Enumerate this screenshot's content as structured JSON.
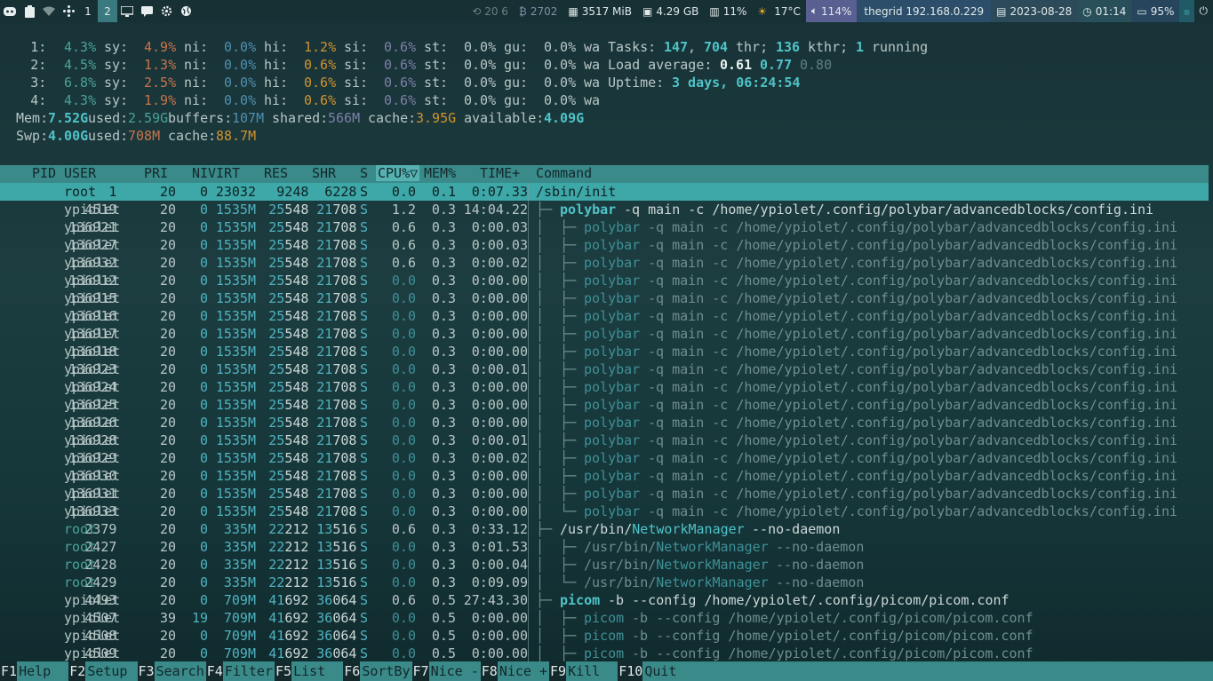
{
  "topbar": {
    "workspaces": [
      "1",
      "2"
    ],
    "active_workspace": "2",
    "blocks": {
      "updates": "20 ⁠6",
      "coins": "2702",
      "mem": "3517 MiB",
      "disk": "4.29 GB",
      "cpu": "11%",
      "temp": "17°C",
      "volume": "114%",
      "host": "thegrid 192.168.0.229",
      "date": "2023-08-28",
      "time": "01:14",
      "battery": "95%"
    }
  },
  "meters": {
    "cpus": [
      {
        "id": "1:",
        "us": "4.3%",
        "sy": "4.9%",
        "ni": "0.0%",
        "hi": "1.2%",
        "si": "0.6%",
        "st": "0.0%",
        "gu": "0.0%"
      },
      {
        "id": "2:",
        "us": "4.5%",
        "sy": "1.3%",
        "ni": "0.0%",
        "hi": "0.6%",
        "si": "0.6%",
        "st": "0.0%",
        "gu": "0.0%"
      },
      {
        "id": "3:",
        "us": "6.8%",
        "sy": "2.5%",
        "ni": "0.0%",
        "hi": "0.6%",
        "si": "0.6%",
        "st": "0.0%",
        "gu": "0.0%"
      },
      {
        "id": "4:",
        "us": "4.3%",
        "sy": "1.9%",
        "ni": "0.0%",
        "hi": "0.6%",
        "si": "0.6%",
        "st": "0.0%",
        "gu": "0.0%"
      }
    ],
    "labels": {
      "sy": "sy:",
      "ni": "ni:",
      "hi": "hi:",
      "si": "si:",
      "st": "st:",
      "gu": "gu:",
      "wa": "wa"
    },
    "tasks": {
      "label": "Tasks:",
      "tasks": "147",
      "thr": "704",
      "thr_label": "thr;",
      "kthr": "136",
      "kthr_label": "kthr;",
      "running": "1",
      "running_label": "running"
    },
    "load": {
      "label": "Load average:",
      "l1": "0.61",
      "l5": "0.77",
      "l15": "0.80"
    },
    "uptime": {
      "label": "Uptime:",
      "value": "3 days, 06:24:54"
    },
    "mem": {
      "label": "Mem:",
      "total": "7.52G",
      "used_label": "used:",
      "used": "2.59G",
      "buffers_label": "buffers:",
      "buffers": "107M",
      "shared_label": "shared:",
      "shared": "566M",
      "cache_label": "cache:",
      "cache": "3.95G",
      "avail_label": "available:",
      "avail": "4.09G"
    },
    "swp": {
      "label": "Swp:",
      "total": "4.00G",
      "used_label": "used:",
      "used": "708M",
      "cache_label": "cache:",
      "cache": "88.7M"
    }
  },
  "table": {
    "headers": [
      "PID",
      "USER",
      "PRI",
      "NI",
      "VIRT",
      "RES",
      "SHR",
      "S",
      "CPU%▽",
      "MEM%",
      "TIME+",
      "Command"
    ],
    "rows": [
      {
        "pid": "1",
        "user": "root",
        "pri": "20",
        "ni": "0",
        "virt": "23032",
        "res": "9248",
        "shr": "6228",
        "s": "S",
        "cpu": "0.0",
        "mem": "0.1",
        "time": "0:07.33",
        "tree": "",
        "cmd_bin": "/sbin/init",
        "cmd_args": "",
        "sel": true,
        "child": false
      },
      {
        "pid": "4519",
        "user": "ypiolet",
        "pri": "20",
        "ni": "0",
        "virt": "1535M",
        "res": "25548",
        "shr": "21708",
        "s": "S",
        "cpu": "1.2",
        "mem": "0.3",
        "time": "14:04.22",
        "tree": "├─ ",
        "cmd_bin": "polybar",
        "cmd_args": " -q main -c /home/ypiolet/.config/polybar/advancedblocks/config.ini",
        "child": false
      },
      {
        "pid": "136921",
        "user": "ypiolet",
        "pri": "20",
        "ni": "0",
        "virt": "1535M",
        "res": "25548",
        "shr": "21708",
        "s": "S",
        "cpu": "0.6",
        "mem": "0.3",
        "time": "0:00.03",
        "tree": "│  ├─ ",
        "cmd_bin": "polybar",
        "cmd_args": " -q main -c /home/ypiolet/.config/polybar/advancedblocks/config.ini",
        "child": true
      },
      {
        "pid": "136927",
        "user": "ypiolet",
        "pri": "20",
        "ni": "0",
        "virt": "1535M",
        "res": "25548",
        "shr": "21708",
        "s": "S",
        "cpu": "0.6",
        "mem": "0.3",
        "time": "0:00.03",
        "tree": "│  ├─ ",
        "cmd_bin": "polybar",
        "cmd_args": " -q main -c /home/ypiolet/.config/polybar/advancedblocks/config.ini",
        "child": true
      },
      {
        "pid": "136932",
        "user": "ypiolet",
        "pri": "20",
        "ni": "0",
        "virt": "1535M",
        "res": "25548",
        "shr": "21708",
        "s": "S",
        "cpu": "0.6",
        "mem": "0.3",
        "time": "0:00.02",
        "tree": "│  ├─ ",
        "cmd_bin": "polybar",
        "cmd_args": " -q main -c /home/ypiolet/.config/polybar/advancedblocks/config.ini",
        "child": true
      },
      {
        "pid": "136912",
        "user": "ypiolet",
        "pri": "20",
        "ni": "0",
        "virt": "1535M",
        "res": "25548",
        "shr": "21708",
        "s": "S",
        "cpu": "0.0",
        "mem": "0.3",
        "time": "0:00.00",
        "tree": "│  ├─ ",
        "cmd_bin": "polybar",
        "cmd_args": " -q main -c /home/ypiolet/.config/polybar/advancedblocks/config.ini",
        "child": true
      },
      {
        "pid": "136915",
        "user": "ypiolet",
        "pri": "20",
        "ni": "0",
        "virt": "1535M",
        "res": "25548",
        "shr": "21708",
        "s": "S",
        "cpu": "0.0",
        "mem": "0.3",
        "time": "0:00.00",
        "tree": "│  ├─ ",
        "cmd_bin": "polybar",
        "cmd_args": " -q main -c /home/ypiolet/.config/polybar/advancedblocks/config.ini",
        "child": true
      },
      {
        "pid": "136916",
        "user": "ypiolet",
        "pri": "20",
        "ni": "0",
        "virt": "1535M",
        "res": "25548",
        "shr": "21708",
        "s": "S",
        "cpu": "0.0",
        "mem": "0.3",
        "time": "0:00.00",
        "tree": "│  ├─ ",
        "cmd_bin": "polybar",
        "cmd_args": " -q main -c /home/ypiolet/.config/polybar/advancedblocks/config.ini",
        "child": true
      },
      {
        "pid": "136917",
        "user": "ypiolet",
        "pri": "20",
        "ni": "0",
        "virt": "1535M",
        "res": "25548",
        "shr": "21708",
        "s": "S",
        "cpu": "0.0",
        "mem": "0.3",
        "time": "0:00.00",
        "tree": "│  ├─ ",
        "cmd_bin": "polybar",
        "cmd_args": " -q main -c /home/ypiolet/.config/polybar/advancedblocks/config.ini",
        "child": true
      },
      {
        "pid": "136918",
        "user": "ypiolet",
        "pri": "20",
        "ni": "0",
        "virt": "1535M",
        "res": "25548",
        "shr": "21708",
        "s": "S",
        "cpu": "0.0",
        "mem": "0.3",
        "time": "0:00.00",
        "tree": "│  ├─ ",
        "cmd_bin": "polybar",
        "cmd_args": " -q main -c /home/ypiolet/.config/polybar/advancedblocks/config.ini",
        "child": true
      },
      {
        "pid": "136923",
        "user": "ypiolet",
        "pri": "20",
        "ni": "0",
        "virt": "1535M",
        "res": "25548",
        "shr": "21708",
        "s": "S",
        "cpu": "0.0",
        "mem": "0.3",
        "time": "0:00.01",
        "tree": "│  ├─ ",
        "cmd_bin": "polybar",
        "cmd_args": " -q main -c /home/ypiolet/.config/polybar/advancedblocks/config.ini",
        "child": true
      },
      {
        "pid": "136924",
        "user": "ypiolet",
        "pri": "20",
        "ni": "0",
        "virt": "1535M",
        "res": "25548",
        "shr": "21708",
        "s": "S",
        "cpu": "0.0",
        "mem": "0.3",
        "time": "0:00.00",
        "tree": "│  ├─ ",
        "cmd_bin": "polybar",
        "cmd_args": " -q main -c /home/ypiolet/.config/polybar/advancedblocks/config.ini",
        "child": true
      },
      {
        "pid": "136925",
        "user": "ypiolet",
        "pri": "20",
        "ni": "0",
        "virt": "1535M",
        "res": "25548",
        "shr": "21708",
        "s": "S",
        "cpu": "0.0",
        "mem": "0.3",
        "time": "0:00.00",
        "tree": "│  ├─ ",
        "cmd_bin": "polybar",
        "cmd_args": " -q main -c /home/ypiolet/.config/polybar/advancedblocks/config.ini",
        "child": true
      },
      {
        "pid": "136926",
        "user": "ypiolet",
        "pri": "20",
        "ni": "0",
        "virt": "1535M",
        "res": "25548",
        "shr": "21708",
        "s": "S",
        "cpu": "0.0",
        "mem": "0.3",
        "time": "0:00.00",
        "tree": "│  ├─ ",
        "cmd_bin": "polybar",
        "cmd_args": " -q main -c /home/ypiolet/.config/polybar/advancedblocks/config.ini",
        "child": true
      },
      {
        "pid": "136928",
        "user": "ypiolet",
        "pri": "20",
        "ni": "0",
        "virt": "1535M",
        "res": "25548",
        "shr": "21708",
        "s": "S",
        "cpu": "0.0",
        "mem": "0.3",
        "time": "0:00.01",
        "tree": "│  ├─ ",
        "cmd_bin": "polybar",
        "cmd_args": " -q main -c /home/ypiolet/.config/polybar/advancedblocks/config.ini",
        "child": true
      },
      {
        "pid": "136929",
        "user": "ypiolet",
        "pri": "20",
        "ni": "0",
        "virt": "1535M",
        "res": "25548",
        "shr": "21708",
        "s": "S",
        "cpu": "0.0",
        "mem": "0.3",
        "time": "0:00.02",
        "tree": "│  ├─ ",
        "cmd_bin": "polybar",
        "cmd_args": " -q main -c /home/ypiolet/.config/polybar/advancedblocks/config.ini",
        "child": true
      },
      {
        "pid": "136930",
        "user": "ypiolet",
        "pri": "20",
        "ni": "0",
        "virt": "1535M",
        "res": "25548",
        "shr": "21708",
        "s": "S",
        "cpu": "0.0",
        "mem": "0.3",
        "time": "0:00.00",
        "tree": "│  ├─ ",
        "cmd_bin": "polybar",
        "cmd_args": " -q main -c /home/ypiolet/.config/polybar/advancedblocks/config.ini",
        "child": true
      },
      {
        "pid": "136931",
        "user": "ypiolet",
        "pri": "20",
        "ni": "0",
        "virt": "1535M",
        "res": "25548",
        "shr": "21708",
        "s": "S",
        "cpu": "0.0",
        "mem": "0.3",
        "time": "0:00.00",
        "tree": "│  ├─ ",
        "cmd_bin": "polybar",
        "cmd_args": " -q main -c /home/ypiolet/.config/polybar/advancedblocks/config.ini",
        "child": true
      },
      {
        "pid": "136933",
        "user": "ypiolet",
        "pri": "20",
        "ni": "0",
        "virt": "1535M",
        "res": "25548",
        "shr": "21708",
        "s": "S",
        "cpu": "0.0",
        "mem": "0.3",
        "time": "0:00.00",
        "tree": "│  └─ ",
        "cmd_bin": "polybar",
        "cmd_args": " -q main -c /home/ypiolet/.config/polybar/advancedblocks/config.ini",
        "child": true
      },
      {
        "pid": "2379",
        "user": "root",
        "pri": "20",
        "ni": "0",
        "virt": "335M",
        "res": "22212",
        "shr": "13516",
        "s": "S",
        "cpu": "0.6",
        "mem": "0.3",
        "time": "0:33.12",
        "tree": "├─ ",
        "cmd_bin": "/usr/bin/NetworkManager",
        "cmd_args": " --no-daemon",
        "child": false
      },
      {
        "pid": "2427",
        "user": "root",
        "pri": "20",
        "ni": "0",
        "virt": "335M",
        "res": "22212",
        "shr": "13516",
        "s": "S",
        "cpu": "0.0",
        "mem": "0.3",
        "time": "0:01.53",
        "tree": "│  ├─ ",
        "cmd_bin": "/usr/bin/NetworkManager",
        "cmd_args": " --no-daemon",
        "child": true
      },
      {
        "pid": "2428",
        "user": "root",
        "pri": "20",
        "ni": "0",
        "virt": "335M",
        "res": "22212",
        "shr": "13516",
        "s": "S",
        "cpu": "0.0",
        "mem": "0.3",
        "time": "0:00.04",
        "tree": "│  ├─ ",
        "cmd_bin": "/usr/bin/NetworkManager",
        "cmd_args": " --no-daemon",
        "child": true
      },
      {
        "pid": "2429",
        "user": "root",
        "pri": "20",
        "ni": "0",
        "virt": "335M",
        "res": "22212",
        "shr": "13516",
        "s": "S",
        "cpu": "0.0",
        "mem": "0.3",
        "time": "0:09.09",
        "tree": "│  └─ ",
        "cmd_bin": "/usr/bin/NetworkManager",
        "cmd_args": " --no-daemon",
        "child": true
      },
      {
        "pid": "4493",
        "user": "ypiolet",
        "pri": "20",
        "ni": "0",
        "virt": "709M",
        "res": "41692",
        "shr": "36064",
        "s": "S",
        "cpu": "0.6",
        "mem": "0.5",
        "time": "27:43.30",
        "tree": "├─ ",
        "cmd_bin": "picom",
        "cmd_args": " -b --config /home/ypiolet/.config/picom/picom.conf",
        "child": false
      },
      {
        "pid": "4507",
        "user": "ypiolet",
        "pri": "39",
        "ni": "19",
        "virt": "709M",
        "res": "41692",
        "shr": "36064",
        "s": "S",
        "cpu": "0.0",
        "mem": "0.5",
        "time": "0:00.00",
        "tree": "│  ├─ ",
        "cmd_bin": "picom",
        "cmd_args": " -b --config /home/ypiolet/.config/picom/picom.conf",
        "child": true
      },
      {
        "pid": "4508",
        "user": "ypiolet",
        "pri": "20",
        "ni": "0",
        "virt": "709M",
        "res": "41692",
        "shr": "36064",
        "s": "S",
        "cpu": "0.0",
        "mem": "0.5",
        "time": "0:00.00",
        "tree": "│  ├─ ",
        "cmd_bin": "picom",
        "cmd_args": " -b --config /home/ypiolet/.config/picom/picom.conf",
        "child": true
      },
      {
        "pid": "4509",
        "user": "ypiolet",
        "pri": "20",
        "ni": "0",
        "virt": "709M",
        "res": "41692",
        "shr": "36064",
        "s": "S",
        "cpu": "0.0",
        "mem": "0.5",
        "time": "0:00.00",
        "tree": "│  ├─ ",
        "cmd_bin": "picom",
        "cmd_args": " -b --config /home/ypiolet/.config/picom/picom.conf",
        "child": true
      }
    ]
  },
  "footer": [
    {
      "key": "F1",
      "label": "Help  "
    },
    {
      "key": "F2",
      "label": "Setup "
    },
    {
      "key": "F3",
      "label": "Search"
    },
    {
      "key": "F4",
      "label": "Filter"
    },
    {
      "key": "F5",
      "label": "List  "
    },
    {
      "key": "F6",
      "label": "SortBy"
    },
    {
      "key": "F7",
      "label": "Nice -"
    },
    {
      "key": "F8",
      "label": "Nice +"
    },
    {
      "key": "F9",
      "label": "Kill  "
    },
    {
      "key": "F10",
      "label": "Quit"
    }
  ],
  "icons": [
    "discord-icon",
    "clipboard-icon",
    "wifi-icon",
    "pinwheel-icon",
    "monitor-icon",
    "chat-icon",
    "gear-icon",
    "globe-icon"
  ]
}
